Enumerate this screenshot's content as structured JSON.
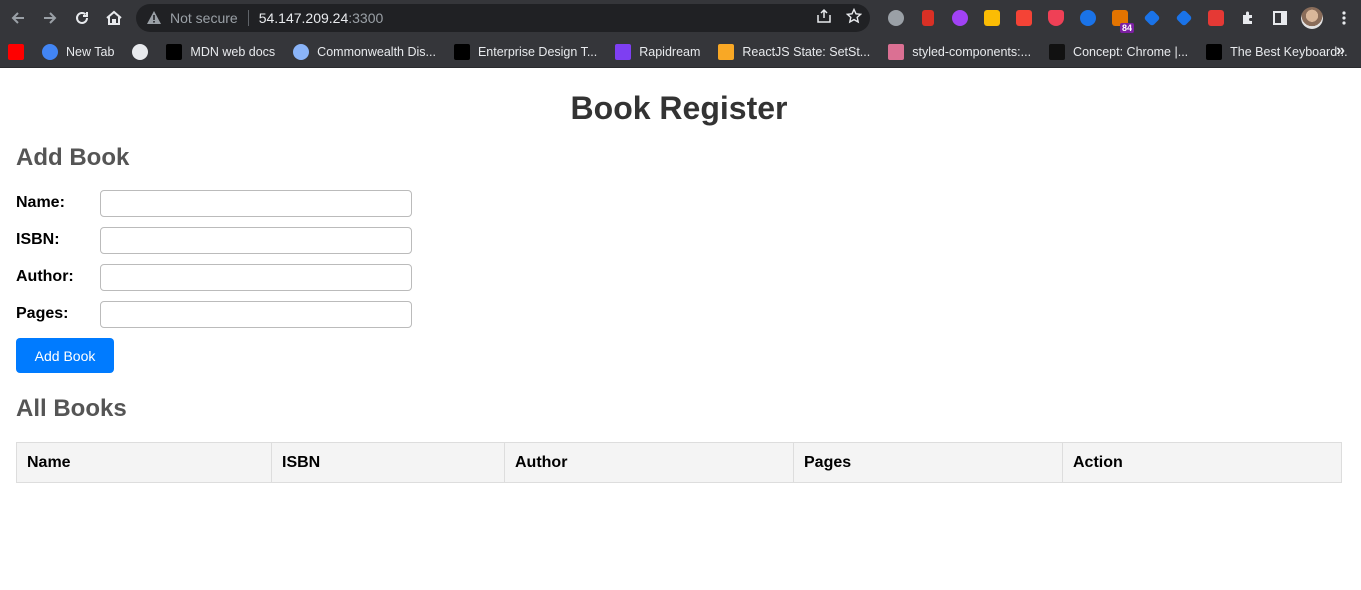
{
  "browser": {
    "omnibox": {
      "security_label": "Not secure",
      "host": "54.147.209.24",
      "port": ":3300"
    },
    "extensions_badge": "84",
    "bookmarks": [
      {
        "label": "",
        "icon": "youtube-icon",
        "color": "#ff0000"
      },
      {
        "label": "New Tab",
        "icon": "google-icon",
        "color": "#4285f4"
      },
      {
        "label": "",
        "icon": "globe-icon",
        "color": "#e8eaed"
      },
      {
        "label": "MDN web docs",
        "icon": "mdn-icon",
        "color": "#000000"
      },
      {
        "label": "Commonwealth Dis...",
        "icon": "globe-icon",
        "color": "#8ab4f8"
      },
      {
        "label": "Enterprise Design T...",
        "icon": "ibm-icon",
        "color": "#000000"
      },
      {
        "label": "Rapidream",
        "icon": "rapidream-icon",
        "color": "#7e3ff2"
      },
      {
        "label": "ReactJS State: SetSt...",
        "icon": "bookmark-icon",
        "color": "#f9a825"
      },
      {
        "label": "styled-components:...",
        "icon": "nail-polish-icon",
        "color": "#db7093"
      },
      {
        "label": "Concept: Chrome |...",
        "icon": "dribbble-icon",
        "color": "#111111"
      },
      {
        "label": "The Best Keyboard...",
        "icon": "htg-icon",
        "color": "#000000"
      }
    ],
    "bookmarks_more": "»"
  },
  "page": {
    "title": "Book Register",
    "add_section": {
      "heading": "Add Book",
      "fields": [
        {
          "label": "Name:",
          "value": "",
          "placeholder": ""
        },
        {
          "label": "ISBN:",
          "value": "",
          "placeholder": ""
        },
        {
          "label": "Author:",
          "value": "",
          "placeholder": ""
        },
        {
          "label": "Pages:",
          "value": "",
          "placeholder": ""
        }
      ],
      "submit_label": "Add Book"
    },
    "list_section": {
      "heading": "All Books",
      "columns": [
        "Name",
        "ISBN",
        "Author",
        "Pages",
        "Action"
      ],
      "rows": []
    }
  },
  "colors": {
    "accent": "#007bff",
    "heading": "#333333",
    "subheading": "#555555"
  }
}
